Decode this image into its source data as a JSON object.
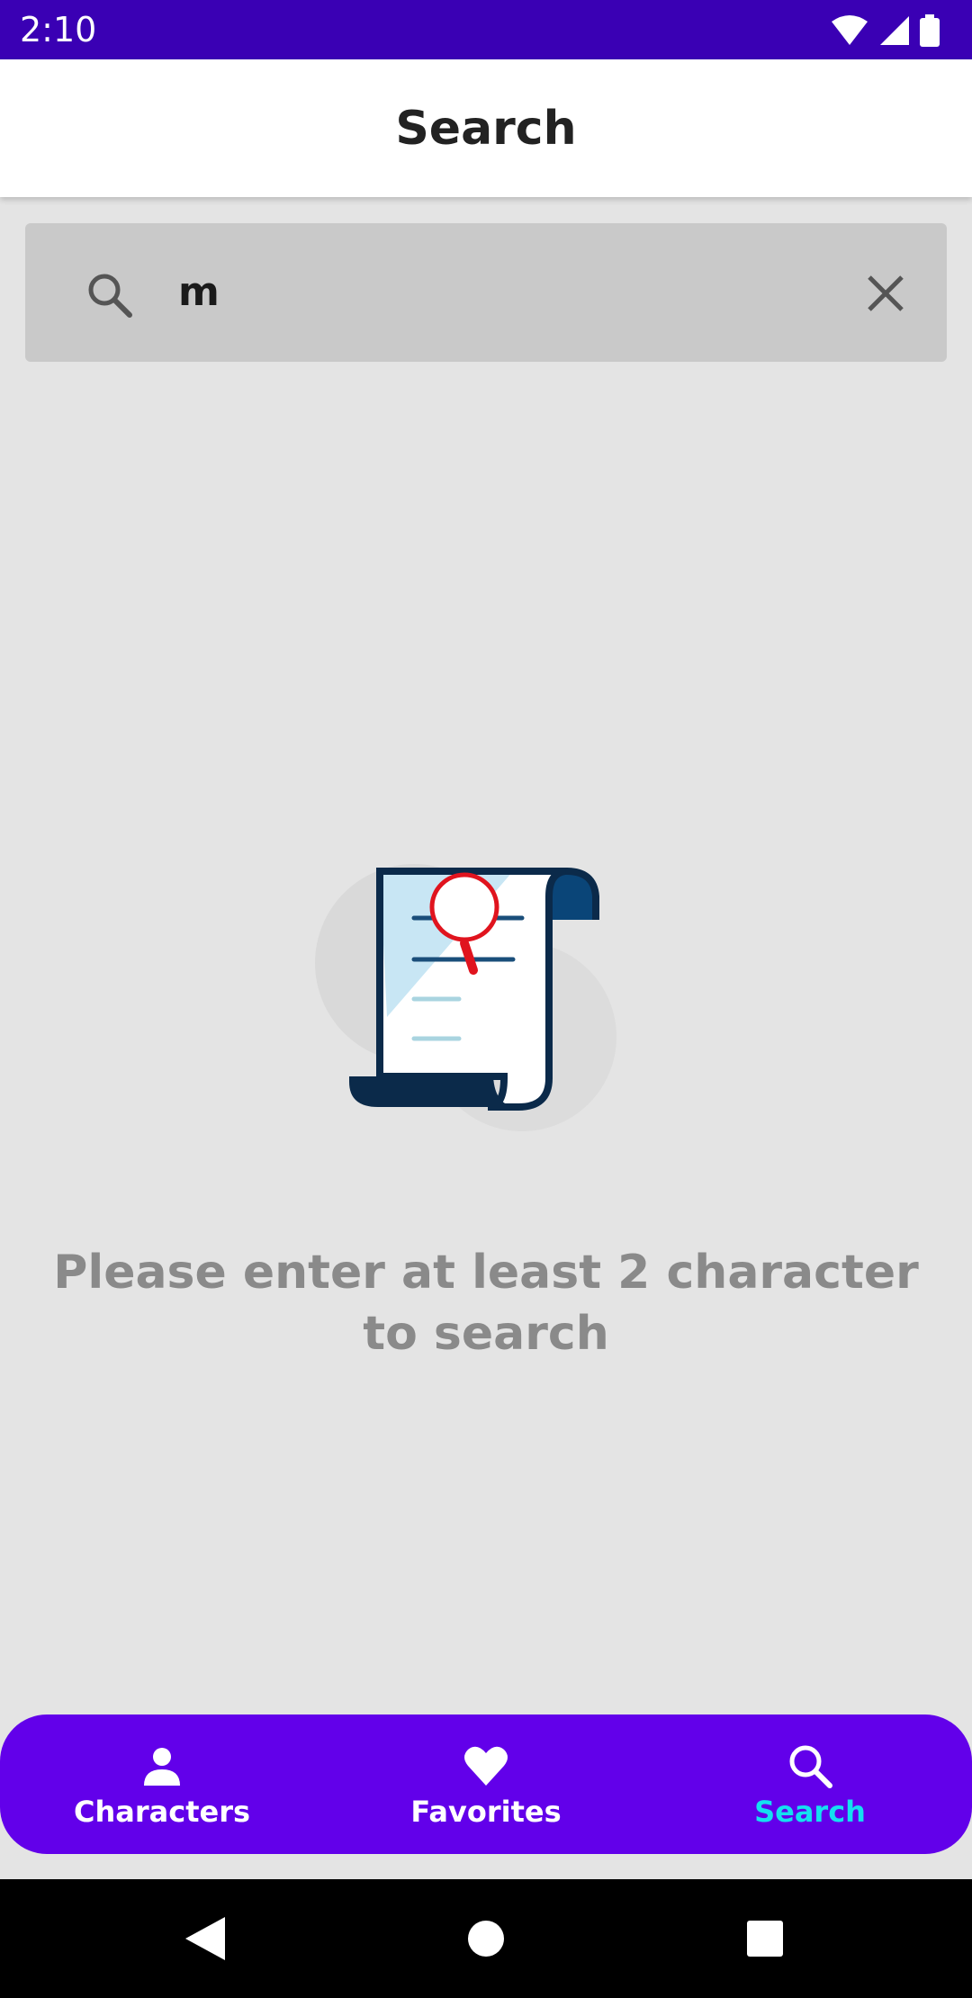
{
  "status_bar": {
    "time": "2:10",
    "icons": [
      "wifi-icon",
      "cell-signal-icon",
      "battery-icon"
    ]
  },
  "app_bar": {
    "title": "Search"
  },
  "search": {
    "value": "m",
    "icon": "search-icon",
    "clear_icon": "close-icon"
  },
  "empty_state": {
    "illustration": "document-search-illustration",
    "message": "Please enter at least 2 character to search"
  },
  "bottom_nav": {
    "items": [
      {
        "label": "Characters",
        "icon": "person-icon",
        "active": false
      },
      {
        "label": "Favorites",
        "icon": "heart-icon",
        "active": false
      },
      {
        "label": "Search",
        "icon": "search-icon",
        "active": true
      }
    ]
  },
  "system_nav": {
    "buttons": [
      "back-icon",
      "home-icon",
      "recents-icon"
    ]
  },
  "colors": {
    "status_bar": "#3a00b4",
    "bottom_nav": "#6200ea",
    "active_nav": "#14e0f0",
    "background": "#e4e4e4",
    "search_field": "#c9c9c9"
  }
}
